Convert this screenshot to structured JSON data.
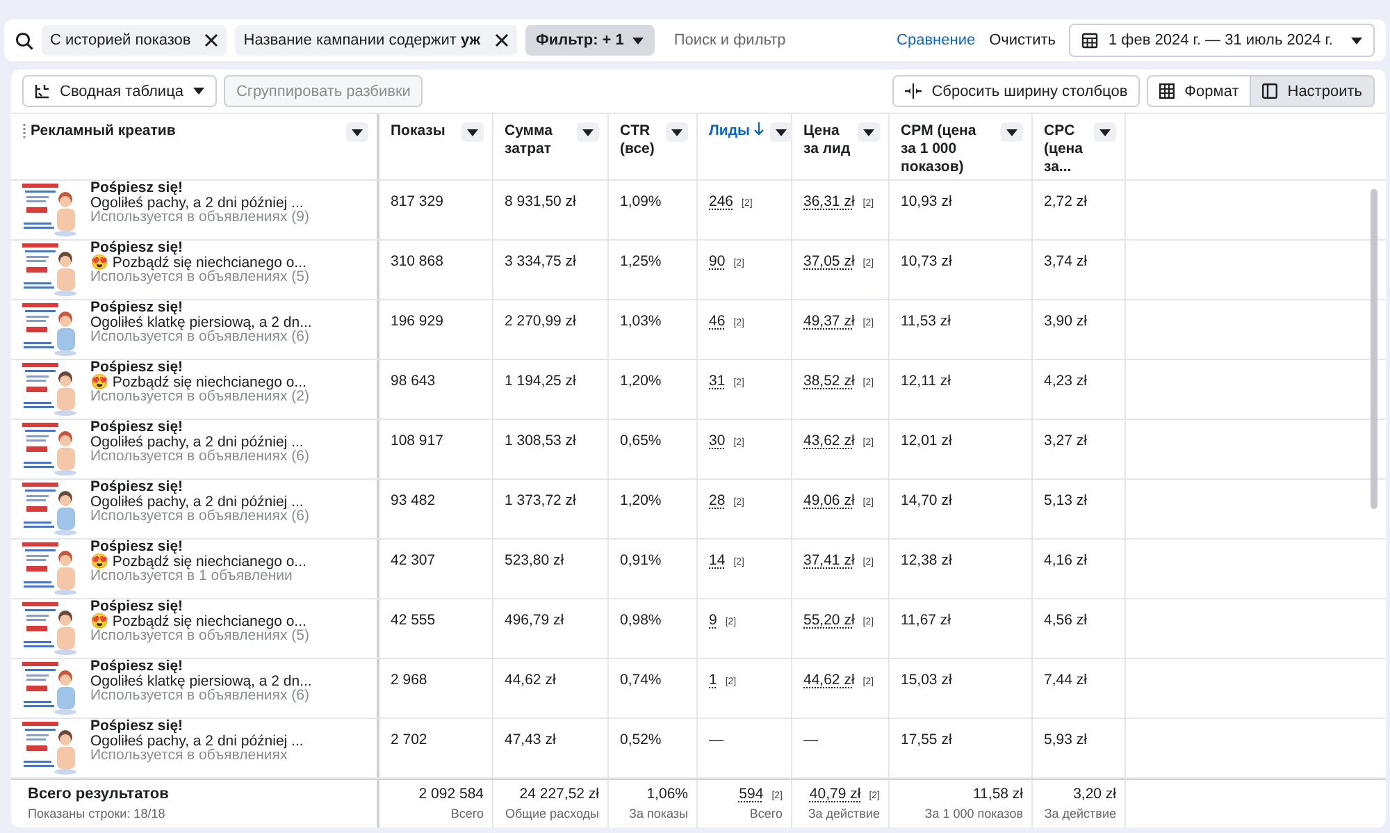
{
  "filter_bar": {
    "chips": [
      {
        "label": "С историей показов"
      },
      {
        "label": "Название кампании содержит **уж**"
      }
    ],
    "filter_button": "Фильтр: + 1",
    "search": {
      "placeholder": "Поиск и фильтр"
    },
    "compare_link": "Сравнение",
    "clear_link": "Очистить",
    "date_range": "1 фев 2024 г. — 31 июль 2024 г."
  },
  "toolbar": {
    "view_select": "Сводная таблица",
    "group_button": {
      "label": "Сгруппировать разбивки",
      "disabled": true
    },
    "reset_button": "Сбросить ширину столбцов",
    "format_button": {
      "label": "Формат",
      "selected": false
    },
    "customize_button": {
      "label": "Настроить",
      "selected": true
    }
  },
  "table": {
    "columns": [
      {
        "label": "Рекламный креатив",
        "sorted": false
      },
      {
        "label": "Показы",
        "sorted": false
      },
      {
        "label": "Сумма затрат",
        "sorted": false
      },
      {
        "label": "CTR (все)",
        "sorted": false
      },
      {
        "label": "Лиды",
        "sorted": true
      },
      {
        "label": "Цена за лид",
        "sorted": false
      },
      {
        "label": "CPM (цена за 1 000 показов)",
        "sorted": false
      },
      {
        "label": "CPC (цена за...",
        "sorted": false
      }
    ],
    "rows": [
      {
        "title": "Pośpiesz się!",
        "text": "Ogoliłeś pachy, a 2 dni później ...",
        "usage": "Используется в объявлениях (9)",
        "impressions": "817 329",
        "spend": "8 931,50 zł",
        "ctr": "1,09%",
        "leads": "246",
        "leads_note": "[2]",
        "cost_per_lead": "36,31 zł",
        "cost_note": "[2]",
        "cpm": "10,93 zł",
        "cpc": "2,72 zł"
      },
      {
        "title": "Pośpiesz się!",
        "text": "😍 Pozbądź się niechcianego o...",
        "usage": "Используется в объявлениях (5)",
        "impressions": "310 868",
        "spend": "3 334,75 zł",
        "ctr": "1,25%",
        "leads": "90",
        "leads_note": "[2]",
        "cost_per_lead": "37,05 zł",
        "cost_note": "[2]",
        "cpm": "10,73 zł",
        "cpc": "3,74 zł"
      },
      {
        "title": "Pośpiesz się!",
        "text": "Ogoliłeś klatkę piersiową, a 2 dn...",
        "usage": "Используется в объявлениях (6)",
        "impressions": "196 929",
        "spend": "2 270,99 zł",
        "ctr": "1,03%",
        "leads": "46",
        "leads_note": "[2]",
        "cost_per_lead": "49,37 zł",
        "cost_note": "[2]",
        "cpm": "11,53 zł",
        "cpc": "3,90 zł"
      },
      {
        "title": "Pośpiesz się!",
        "text": "😍 Pozbądź się niechcianego o...",
        "usage": "Используется в объявлениях (2)",
        "impressions": "98 643",
        "spend": "1 194,25 zł",
        "ctr": "1,20%",
        "leads": "31",
        "leads_note": "[2]",
        "cost_per_lead": "38,52 zł",
        "cost_note": "[2]",
        "cpm": "12,11 zł",
        "cpc": "4,23 zł"
      },
      {
        "title": "Pośpiesz się!",
        "text": "Ogoliłeś pachy, a 2 dni później ...",
        "usage": "Используется в объявлениях (6)",
        "impressions": "108 917",
        "spend": "1 308,53 zł",
        "ctr": "0,65%",
        "leads": "30",
        "leads_note": "[2]",
        "cost_per_lead": "43,62 zł",
        "cost_note": "[2]",
        "cpm": "12,01 zł",
        "cpc": "3,27 zł"
      },
      {
        "title": "Pośpiesz się!",
        "text": "Ogoliłeś pachy, a 2 dni później ...",
        "usage": "Используется в объявлениях (6)",
        "impressions": "93 482",
        "spend": "1 373,72 zł",
        "ctr": "1,20%",
        "leads": "28",
        "leads_note": "[2]",
        "cost_per_lead": "49,06 zł",
        "cost_note": "[2]",
        "cpm": "14,70 zł",
        "cpc": "5,13 zł"
      },
      {
        "title": "Pośpiesz się!",
        "text": "😍 Pozbądź się niechcianego o...",
        "usage": "Используется в 1 объявлении",
        "impressions": "42 307",
        "spend": "523,80 zł",
        "ctr": "0,91%",
        "leads": "14",
        "leads_note": "[2]",
        "cost_per_lead": "37,41 zł",
        "cost_note": "[2]",
        "cpm": "12,38 zł",
        "cpc": "4,16 zł"
      },
      {
        "title": "Pośpiesz się!",
        "text": "😍 Pozbądź się niechcianego o...",
        "usage": "Используется в объявлениях (5)",
        "impressions": "42 555",
        "spend": "496,79 zł",
        "ctr": "0,98%",
        "leads": "9",
        "leads_note": "[2]",
        "cost_per_lead": "55,20 zł",
        "cost_note": "[2]",
        "cpm": "11,67 zł",
        "cpc": "4,56 zł"
      },
      {
        "title": "Pośpiesz się!",
        "text": "Ogoliłeś klatkę piersiową, a 2 dn...",
        "usage": "Используется в объявлениях (6)",
        "impressions": "2 968",
        "spend": "44,62 zł",
        "ctr": "0,74%",
        "leads": "1",
        "leads_note": "[2]",
        "cost_per_lead": "44,62 zł",
        "cost_note": "[2]",
        "cpm": "15,03 zł",
        "cpc": "7,44 zł"
      },
      {
        "title": "Pośpiesz się!",
        "text": "Ogoliłeś pachy, a 2 dni później ...",
        "usage": "Используется в объявлениях",
        "impressions": "2 702",
        "spend": "47,43 zł",
        "ctr": "0,52%",
        "leads": "—",
        "cost_per_lead": "—",
        "cpm": "17,55 zł",
        "cpc": "5,93 zł"
      }
    ],
    "footer": {
      "title": "Всего результатов",
      "subtitle": "Показаны строки: 18/18",
      "cells": [
        {
          "value": "2 092 584",
          "caption": "Всего"
        },
        {
          "value": "24 227,52 zł",
          "caption": "Общие расходы"
        },
        {
          "value": "1,06%",
          "caption": "За показы"
        },
        {
          "value": "594",
          "note": "[2]",
          "caption": "Всего"
        },
        {
          "value": "40,79 zł",
          "note": "[2]",
          "caption": "За действие"
        },
        {
          "value": "11,58 zł",
          "caption": "За 1 000 показов"
        },
        {
          "value": "3,20 zł",
          "caption": "За действие"
        }
      ]
    }
  }
}
